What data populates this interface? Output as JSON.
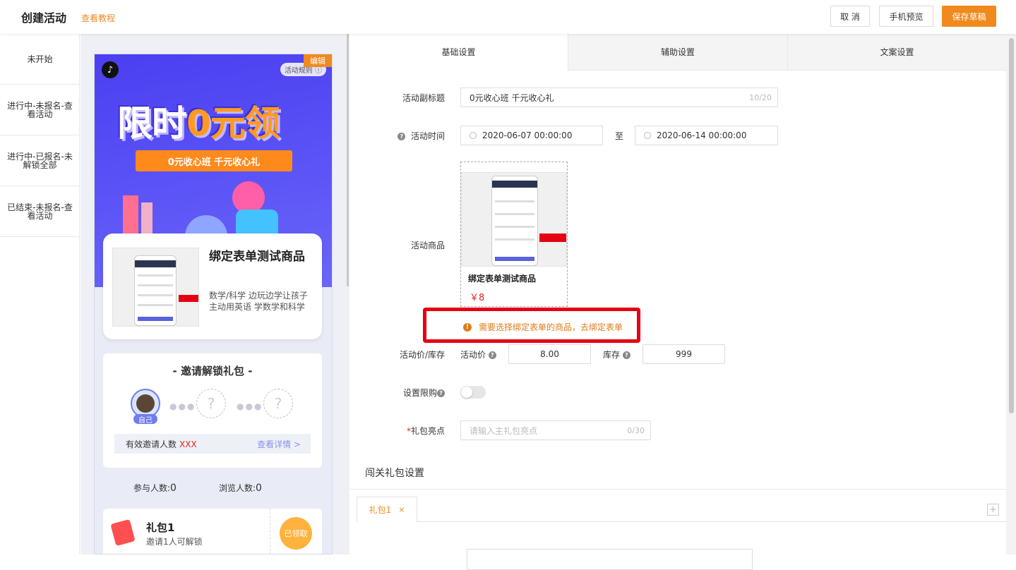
{
  "header": {
    "title": "创建活动",
    "tutorial_link": "查看教程",
    "cancel_label": "取 消",
    "preview_label": "手机预览",
    "save_label": "保存草稿"
  },
  "left_nav": {
    "items": [
      {
        "label": "未开始"
      },
      {
        "label": "进行中-未报名-查看活动"
      },
      {
        "label": "进行中-已报名-未解锁全部"
      },
      {
        "label": "已结束-未报名-查看活动"
      }
    ]
  },
  "preview": {
    "edit_label": "编辑",
    "rules_label": "活动规则",
    "hero_title_part1": "限时",
    "hero_title_part2": "0元领",
    "hero_ribbon": "0元收心班 千元收心礼",
    "product": {
      "title": "绑定表单测试商品",
      "desc": "数学/科学 边玩边学让孩子主动用英语 学数学和科学"
    },
    "invite": {
      "title": "- 邀请解锁礼包 -",
      "self_label": "自己",
      "count_label": "有效邀请人数",
      "count_value": "XXX",
      "detail_link": "查看详情 >"
    },
    "stats": {
      "participants_label": "参与人数:",
      "participants_value": "0",
      "views_label": "浏览人数:",
      "views_value": "0"
    },
    "gift": {
      "title": "礼包1",
      "subtitle": "邀请1人可解锁",
      "stamp": "已领取"
    }
  },
  "settings": {
    "tabs": [
      {
        "label": "基础设置",
        "active": true
      },
      {
        "label": "辅助设置",
        "active": false
      },
      {
        "label": "文案设置",
        "active": false
      }
    ],
    "subtitle": {
      "label": "活动副标题",
      "value": "0元收心班 千元收心礼",
      "counter": "10/20"
    },
    "time": {
      "label": "活动时间",
      "start": "2020-06-07 00:00:00",
      "separator": "至",
      "end": "2020-06-14 00:00:00"
    },
    "goods": {
      "label": "活动商品",
      "name": "绑定表单测试商品",
      "price": "￥8"
    },
    "warning": "需要选择绑定表单的商品，去绑定表单",
    "price_stock": {
      "label": "活动价/库存",
      "price_label": "活动价",
      "price_value": "8.00",
      "stock_label": "库存",
      "stock_value": "999"
    },
    "limit": {
      "label": "设置限购",
      "enabled": false
    },
    "highlight": {
      "required_mark": "*",
      "label": "礼包亮点",
      "placeholder": "请输入主礼包亮点",
      "counter": "0/30"
    },
    "pack_section": {
      "title": "闯关礼包设置",
      "tab_label": "礼包1",
      "close_symbol": "×",
      "add_symbol": "+"
    }
  },
  "colors": {
    "accent": "#f08a1e",
    "warning_border": "#e50012",
    "price": "#e0271b",
    "hero_bg": "#4b3ff0"
  }
}
